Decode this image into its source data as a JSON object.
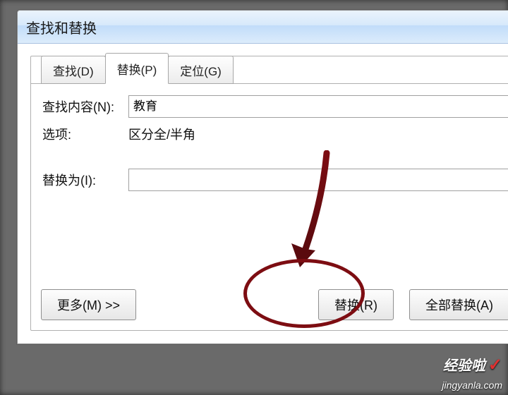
{
  "dialog": {
    "title": "查找和替换",
    "tabs": {
      "find": "查找(D)",
      "replace": "替换(P)",
      "goto": "定位(G)"
    },
    "labels": {
      "find_what": "查找内容(N):",
      "options": "选项:",
      "replace_with": "替换为(I):"
    },
    "values": {
      "find_what": "教育",
      "options": "区分全/半角",
      "replace_with": ""
    },
    "buttons": {
      "more": "更多(M) >>",
      "replace": "替换(R)",
      "replace_all": "全部替换(A)"
    }
  },
  "watermark": {
    "brand": "经验啦",
    "url": "jingyanla.com"
  }
}
